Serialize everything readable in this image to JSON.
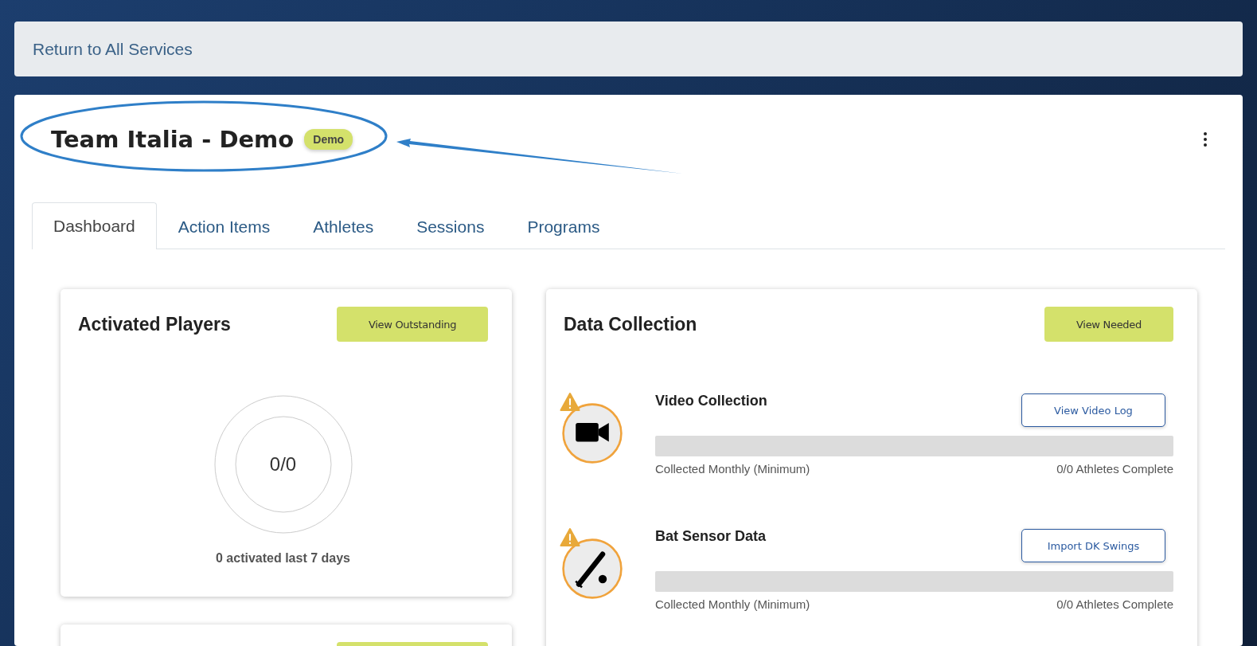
{
  "top_bar": {
    "link": "Return to All Services"
  },
  "header": {
    "title": "Team Italia - Demo",
    "badge": "Demo"
  },
  "tabs": [
    {
      "label": "Dashboard",
      "selected": true
    },
    {
      "label": "Action Items",
      "selected": false
    },
    {
      "label": "Athletes",
      "selected": false
    },
    {
      "label": "Sessions",
      "selected": false
    },
    {
      "label": "Programs",
      "selected": false
    }
  ],
  "activated_players": {
    "title": "Activated Players",
    "button": "View Outstanding",
    "count": "0/0",
    "caption": "0 activated last 7 days"
  },
  "data_collection": {
    "title": "Data Collection",
    "button": "View Needed",
    "items": [
      {
        "kind": "video",
        "title": "Video Collection",
        "button": "View Video Log",
        "warning": true,
        "level": 0,
        "frequency": "Collected Monthly (Minimum)",
        "status": "0/0 Athletes Complete"
      },
      {
        "kind": "bat",
        "title": "Bat Sensor Data",
        "button": "Import DK Swings",
        "warning": true,
        "level": 0,
        "frequency": "Collected Monthly (Minimum)",
        "status": "0/0 Athletes Complete"
      }
    ]
  }
}
